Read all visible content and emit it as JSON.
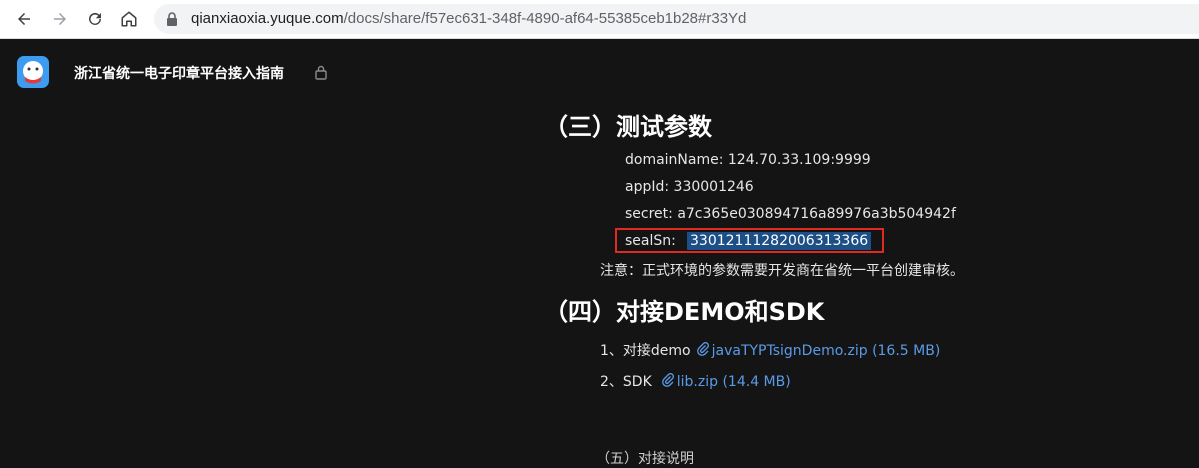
{
  "browser": {
    "url_host": "qianxiaoxia.yuque.com",
    "url_path": "/docs/share/f57ec631-348f-4890-af64-55385ceb1b28#r33Yd"
  },
  "doc": {
    "title": "浙江省统一电子印章平台接入指南"
  },
  "sections": {
    "s3_heading": "（三）测试参数",
    "params": [
      "domainName: 124.70.33.109:9999",
      "appId: 330001246",
      "secret: a7c365e030894716a89976a3b504942f"
    ],
    "seal_label": "sealSn:",
    "seal_value": "33012111282006313366",
    "note": "注意：正式环境的参数需要开发商在省统一平台创建审核。",
    "s4_heading": "（四）对接DEMO和SDK",
    "attachments": [
      {
        "prefix": "1、对接demo",
        "file": "javaTYPTsignDemo.zip",
        "size": "(16.5 MB)"
      },
      {
        "prefix": "2、SDK",
        "file": "lib.zip",
        "size": "(14.4 MB)"
      }
    ],
    "cut_off_line": "（五）对接说明"
  },
  "colors": {
    "page_bg": "#141414",
    "link": "#5a9be8",
    "highlight": "#1d4f87",
    "annotation_border": "#e02a20"
  }
}
